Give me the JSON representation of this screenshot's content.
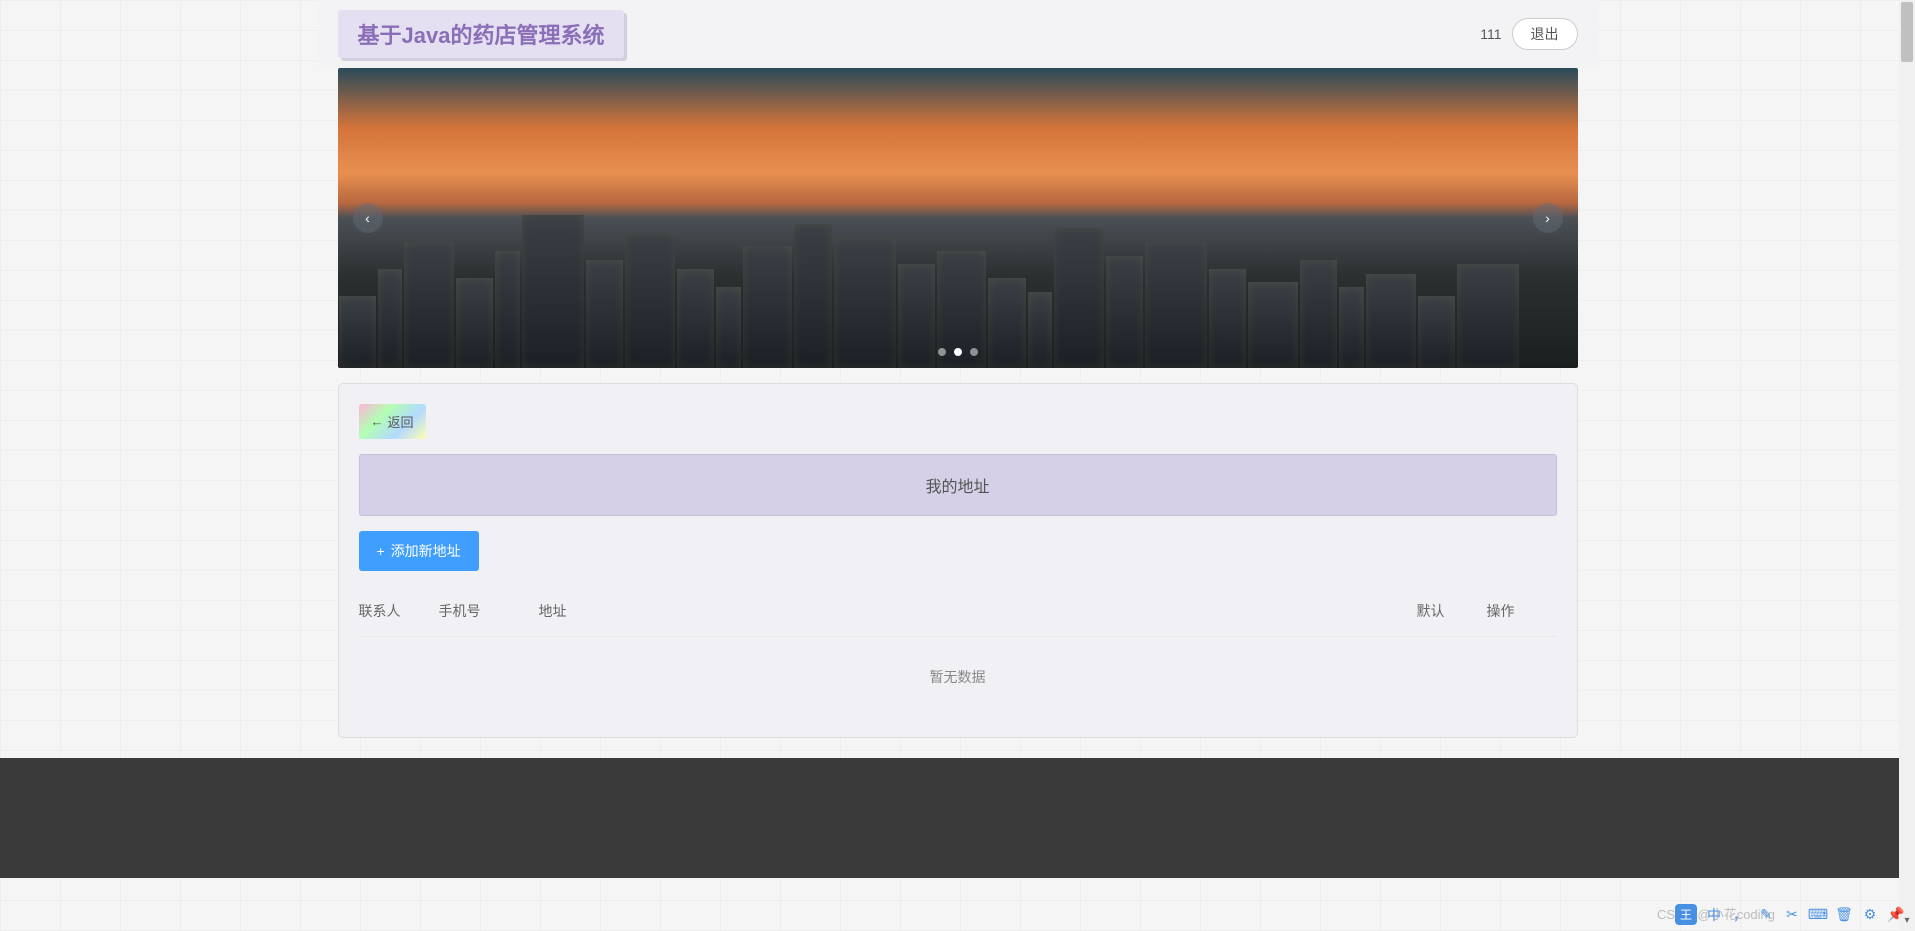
{
  "header": {
    "title": "基于Java的药店管理系统",
    "user": "111",
    "logout": "退出"
  },
  "carousel": {
    "arrows": {
      "left": "‹",
      "right": "›"
    },
    "dots_count": 3,
    "active_dot": 1
  },
  "content": {
    "back_button": "返回",
    "section_title": "我的地址",
    "add_button": "添加新地址",
    "columns": {
      "contact": "联系人",
      "phone": "手机号",
      "address": "地址",
      "default": "默认",
      "action": "操作"
    },
    "empty_text": "暂无数据"
  },
  "watermark": "CSDN @小花coding",
  "taskbar": {
    "badge": "王",
    "ime": "中"
  }
}
